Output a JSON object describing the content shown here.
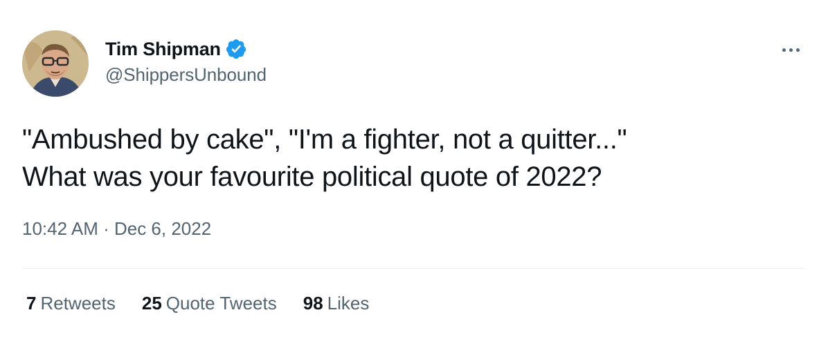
{
  "author": {
    "display_name": "Tim Shipman",
    "handle": "@ShippersUnbound",
    "verified": true,
    "verified_color": "#1d9bf0"
  },
  "tweet": {
    "text_lines": [
      "\"Ambushed by cake\", \"I'm a fighter, not a quitter...\"",
      "What was your favourite political quote of 2022?"
    ],
    "time": "10:42 AM",
    "separator": " · ",
    "date": "Dec 6, 2022"
  },
  "stats": [
    {
      "count": "7",
      "label": "Retweets"
    },
    {
      "count": "25",
      "label": "Quote Tweets"
    },
    {
      "count": "98",
      "label": "Likes"
    }
  ],
  "colors": {
    "text_primary": "#0f1419",
    "text_secondary": "#536471",
    "divider": "#eff3f4"
  },
  "icons": {
    "verified": "verified-badge-icon",
    "more": "more-horizontal-icon"
  }
}
